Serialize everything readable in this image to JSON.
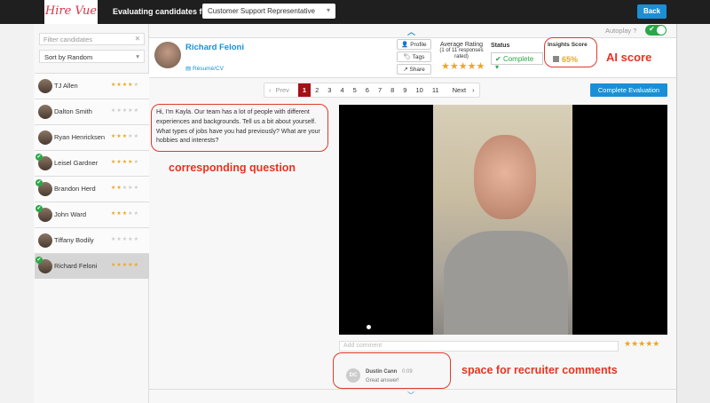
{
  "topbar": {
    "logo": "Hire Vue",
    "eval_label": "Evaluating candidates for:",
    "job": "Customer Support Representative",
    "back": "Back"
  },
  "sidebar": {
    "filter_placeholder": "Filter candidates",
    "sort": "Sort by Random",
    "candidates": [
      {
        "name": "TJ Allen",
        "rating": 4,
        "reviewed": false
      },
      {
        "name": "Dalton Smith",
        "rating": 0,
        "reviewed": false
      },
      {
        "name": "Ryan Henricksen",
        "rating": 3,
        "reviewed": false
      },
      {
        "name": "Leisel Gardner",
        "rating": 4,
        "reviewed": true
      },
      {
        "name": "Brandon Herd",
        "rating": 2,
        "reviewed": true
      },
      {
        "name": "John Ward",
        "rating": 3,
        "reviewed": true
      },
      {
        "name": "Tiffany Bodily",
        "rating": 0,
        "reviewed": false
      },
      {
        "name": "Richard Feloni",
        "rating": 5,
        "reviewed": true,
        "selected": true
      }
    ]
  },
  "header": {
    "autoplay": "Autoplay",
    "autoplay_on": true,
    "candidate": "Richard Feloni",
    "resume": "Résumé/CV",
    "profile": "Profile",
    "tags": "Tags",
    "share": "Share",
    "avg_rating_label": "Average Rating",
    "avg_rating_sub": "(1 of 11 responses rated)",
    "avg_rating": 5,
    "status_label": "Status",
    "status": "Complete",
    "insights_label": "Insights Score",
    "insights_score": "65%"
  },
  "pager": {
    "prev": "Prev",
    "pages": [
      "1",
      "2",
      "3",
      "4",
      "5",
      "6",
      "7",
      "8",
      "9",
      "10",
      "11"
    ],
    "current": "1",
    "next": "Next"
  },
  "complete_btn": "Complete Evaluation",
  "question": "Hi, I'm Kayla. Our team has a lot of people with different experiences and backgrounds. Tell us a bit about yourself. What types of jobs have you had previously? What are your hobbies and interests?",
  "comments": {
    "placeholder": "Add comment",
    "rating": 5,
    "items": [
      {
        "initials": "DC",
        "author": "Dustin Cann",
        "time": "0:09",
        "text": "Great answer!"
      }
    ]
  },
  "annotations": {
    "ai": "AI score",
    "question": "corresponding question",
    "comments": "space for recruiter comments"
  },
  "colors": {
    "accent": "#1a8fd6",
    "star": "#f0a51f",
    "annotation": "#e8321e",
    "page_active": "#a50f15",
    "success": "#29a847"
  }
}
